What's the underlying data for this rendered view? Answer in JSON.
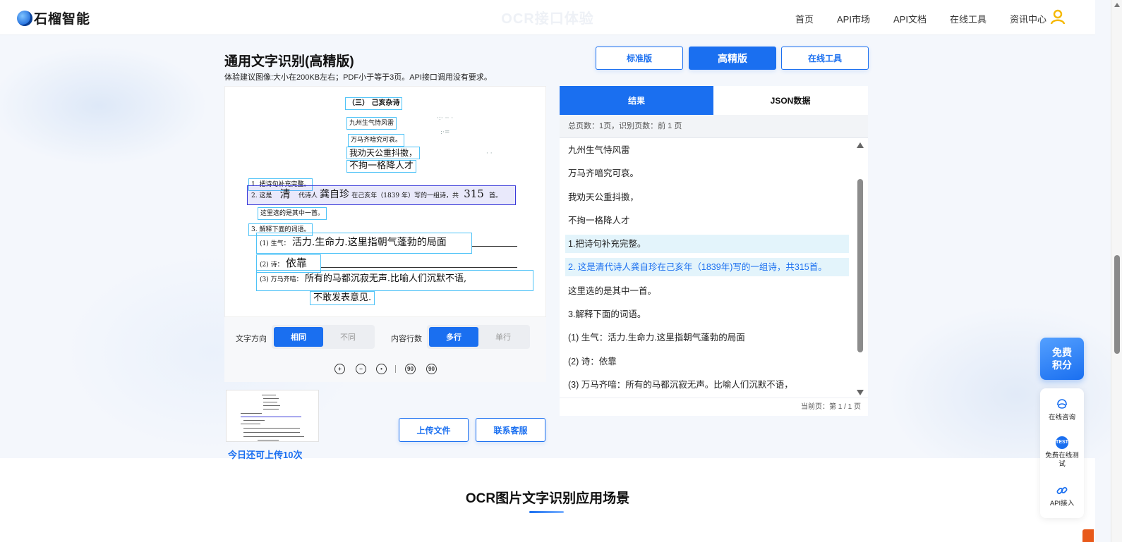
{
  "header": {
    "brand": "石榴智能",
    "ghost_title": "OCR接口体验",
    "nav": [
      "首页",
      "API市场",
      "API文档",
      "在线工具",
      "资讯中心"
    ]
  },
  "page": {
    "title": "通用文字识别(高精版)",
    "subtitle": "体验建议图像:大小在200KB左右；PDF小于等于3页。API接口调用没有要求。",
    "modes": [
      "标准版",
      "高精版",
      "在线工具"
    ],
    "active_mode": "高精版"
  },
  "document": {
    "lines": [
      "（三） 己亥杂诗",
      "九州生气恃风雷",
      "万马齐喑究可哀。",
      "我劝天公重抖擞，",
      "不拘一格降人才",
      "1. 把诗句补充完整。",
      "2. 这是",
      "清",
      "代诗人",
      "龚自珍",
      "在己亥年（1839 年）写的一组诗，共",
      "315",
      "首。",
      "这里选的是其中一首。",
      "3. 解释下面的词语。",
      "(1) 生气：",
      "活力.生命力.这里指朝气蓬勃的局面",
      "(2) 诗：",
      "依靠",
      "(3) 万马齐喑：",
      "所有的马都沉寂无声.比喻人们沉默不语,",
      "不敢发表意见."
    ]
  },
  "options": {
    "direction_label": "文字方向",
    "direction_options": [
      "相同",
      "不同"
    ],
    "direction_selected": "相同",
    "lines_label": "内容行数",
    "lines_options": [
      "多行",
      "单行"
    ],
    "lines_selected": "多行",
    "tools": [
      "zoom-in-icon",
      "zoom-out-icon",
      "reset-icon",
      "rotate-left-icon",
      "rotate-right-icon"
    ],
    "tool_glyphs": {
      "rotate_left": "90",
      "rotate_right": "90"
    }
  },
  "upload": {
    "note": "今日还可上传10次",
    "upload_button": "上传文件",
    "contact_button": "联系客服"
  },
  "result": {
    "tabs": [
      "结果",
      "JSON数据"
    ],
    "active_tab": "结果",
    "stats": "总页数：1页，识别页数：前 1 页",
    "lines": [
      "九州生气恃风雷",
      "万马齐喑究可哀。",
      "我劝天公重抖擞，",
      "不拘一格降人才",
      "1.把诗句补充完整。",
      "2. 这是清代诗人龚自珍在己亥年（1839年)写的一组诗，共315首。",
      "这里选的是其中一首。",
      "3.解释下面的词语。",
      "(1) 生气：活力.生命力.这里指朝气蓬勃的局面",
      "(2) 诗：依靠",
      "(3) 万马齐喑：所有的马都沉寂无声。比喻人们沉默不语，"
    ],
    "page_info": "当前页：第 1 / 1 页"
  },
  "section": {
    "title": "OCR图片文字识别应用场景"
  },
  "side": {
    "free_points": [
      "免费",
      "积分"
    ],
    "items": [
      {
        "label": "在线咨询",
        "icon": "headset-icon"
      },
      {
        "label": "免费在线测试",
        "icon": "test-icon",
        "icon_text": "TEST"
      },
      {
        "label": "API接入",
        "icon": "link-icon"
      }
    ]
  },
  "colors": {
    "primary": "#1a6ff0",
    "selected_row": "#e3f4fb",
    "box": "#4fc3f7"
  }
}
